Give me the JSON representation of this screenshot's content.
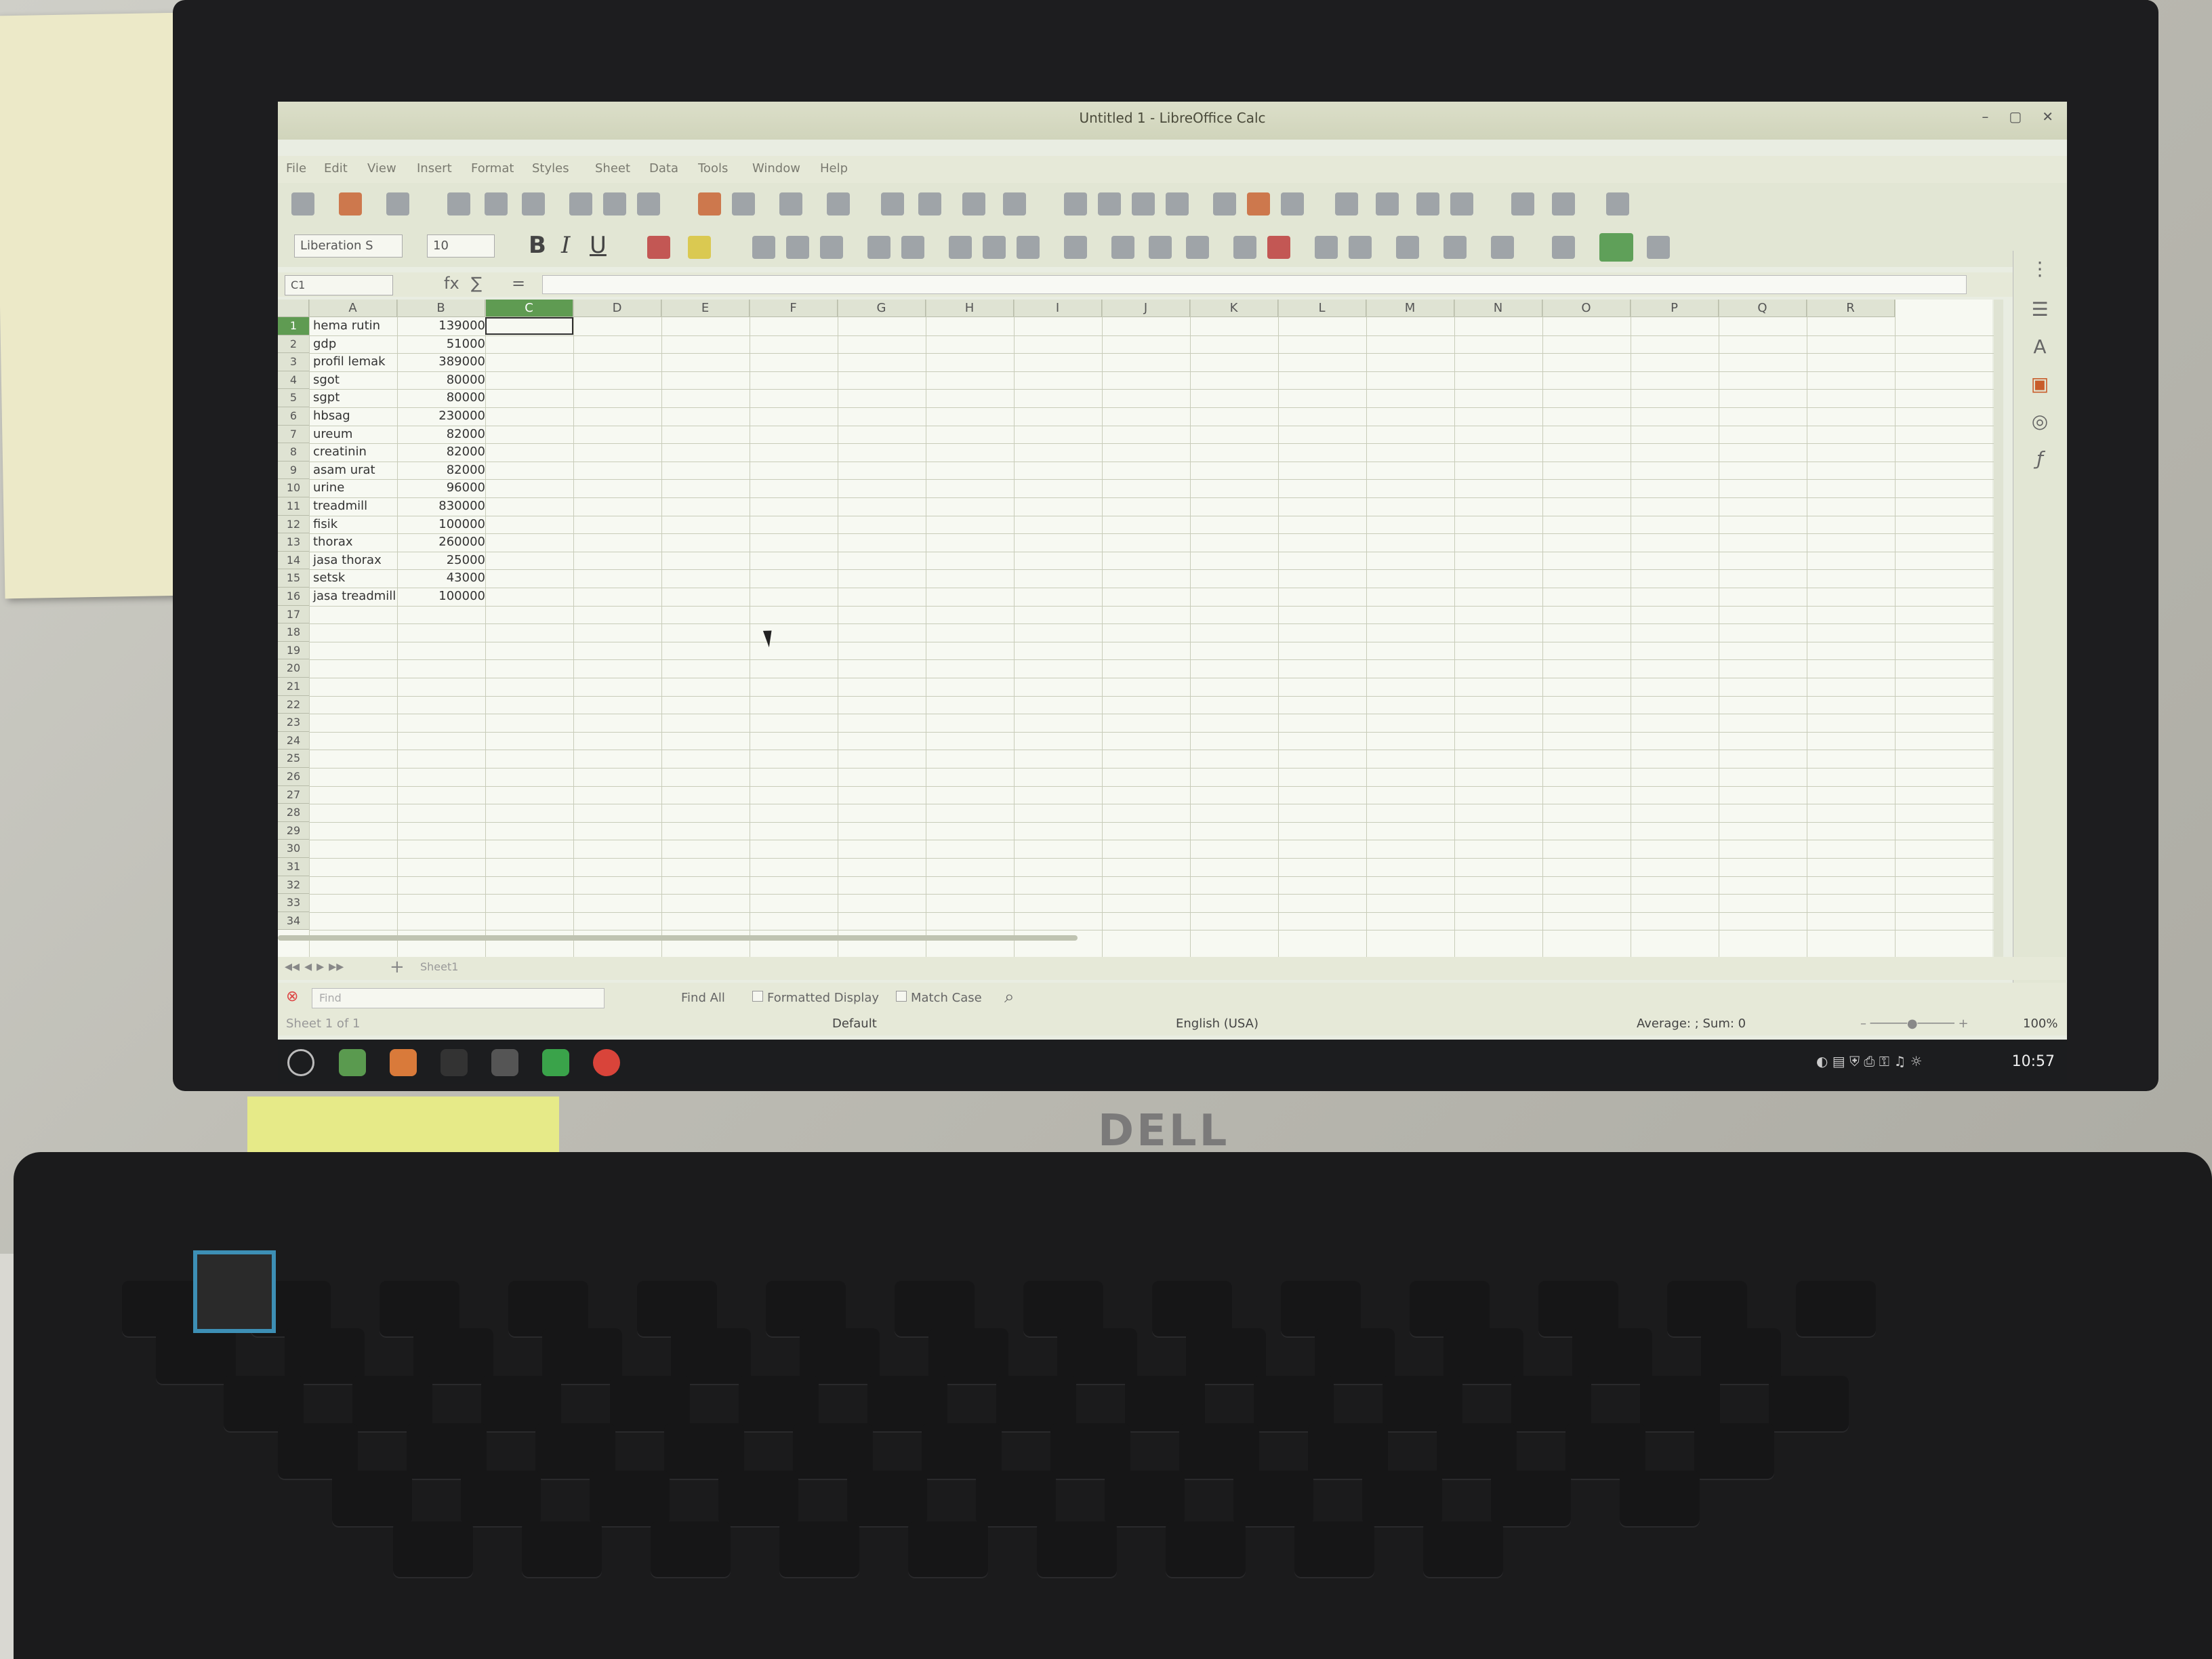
{
  "window": {
    "title": "Untitled 1 - LibreOffice Calc"
  },
  "menu": [
    "File",
    "Edit",
    "View",
    "Insert",
    "Format",
    "Styles",
    "Sheet",
    "Data",
    "Tools",
    "Window",
    "Help"
  ],
  "toolbar": {
    "font_name": "Liberation S",
    "font_size": "10",
    "bold": "B",
    "italic": "I",
    "underline": "U"
  },
  "formula_bar": {
    "name_box": "C1",
    "fx": "fx",
    "sum": "∑",
    "equals": "="
  },
  "columns": [
    "A",
    "B",
    "C",
    "D",
    "E",
    "F",
    "G",
    "H",
    "I",
    "J",
    "K",
    "L",
    "M",
    "N",
    "O",
    "P",
    "Q",
    "R"
  ],
  "selected_column": "C",
  "rows": [
    {
      "n": "1",
      "a": "hema rutin",
      "b": "139000"
    },
    {
      "n": "2",
      "a": "gdp",
      "b": "51000"
    },
    {
      "n": "3",
      "a": "profil lemak",
      "b": "389000"
    },
    {
      "n": "4",
      "a": "sgot",
      "b": "80000"
    },
    {
      "n": "5",
      "a": "sgpt",
      "b": "80000"
    },
    {
      "n": "6",
      "a": "hbsag",
      "b": "230000"
    },
    {
      "n": "7",
      "a": "ureum",
      "b": "82000"
    },
    {
      "n": "8",
      "a": "creatinin",
      "b": "82000"
    },
    {
      "n": "9",
      "a": "asam urat",
      "b": "82000"
    },
    {
      "n": "10",
      "a": "urine",
      "b": "96000"
    },
    {
      "n": "11",
      "a": "treadmill",
      "b": "830000"
    },
    {
      "n": "12",
      "a": "fisik",
      "b": "100000"
    },
    {
      "n": "13",
      "a": "thorax",
      "b": "260000"
    },
    {
      "n": "14",
      "a": "jasa thorax",
      "b": "25000"
    },
    {
      "n": "15",
      "a": "setsk",
      "b": "43000"
    },
    {
      "n": "16",
      "a": "jasa treadmill",
      "b": "100000"
    }
  ],
  "empty_rows": [
    "17",
    "18",
    "19",
    "20",
    "21",
    "22",
    "23",
    "24",
    "25",
    "26",
    "27",
    "28",
    "29",
    "30",
    "31",
    "32",
    "33",
    "34"
  ],
  "sheet_tab": "Sheet1",
  "find": {
    "placeholder": "Find",
    "find_all": "Find All",
    "formatted_display": "Formatted Display",
    "match_case": "Match Case"
  },
  "status": {
    "sheet": "Sheet 1 of 1",
    "style": "Default",
    "language": "English (USA)",
    "summary": "Average: ; Sum: 0",
    "zoom": "100%"
  },
  "taskbar": {
    "clock": "10:57"
  },
  "hardware": {
    "brand": "DELL"
  }
}
